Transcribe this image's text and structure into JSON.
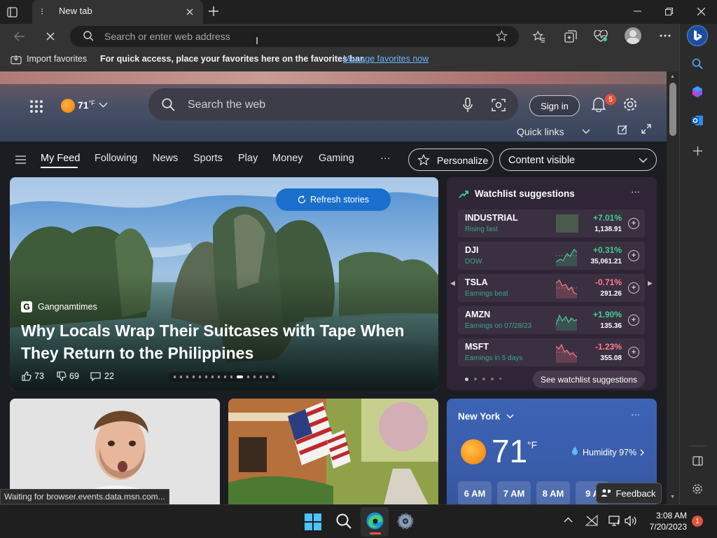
{
  "browser": {
    "tab_title": "New tab",
    "address_placeholder": "Search or enter web address",
    "favorites": {
      "import_label": "Import favorites",
      "hint": "For quick access, place your favorites here on the favorites bar.",
      "manage_link": "Manage favorites now"
    },
    "status_text": "Waiting for browser.events.data.msn.com..."
  },
  "msn": {
    "weather_chip": {
      "temp": "71",
      "unit": "°F"
    },
    "search_placeholder": "Search the web",
    "signin_label": "Sign in",
    "notification_count": "5",
    "quick_links_label": "Quick links",
    "nav": [
      "My Feed",
      "Following",
      "News",
      "Sports",
      "Play",
      "Money",
      "Gaming"
    ],
    "more_label": "···",
    "personalize_label": "Personalize",
    "content_visible_label": "Content visible",
    "hero": {
      "refresh_label": "Refresh stories",
      "source": "Gangnamtimes",
      "title": "Why Locals Wrap Their Suitcases with Tape When They Return to the Philippines",
      "likes": "73",
      "dislikes": "69",
      "comments": "22",
      "carousel_total": 16,
      "carousel_active": 10
    },
    "watchlist": {
      "title": "Watchlist suggestions",
      "more_label": "···",
      "stocks": [
        {
          "symbol": "INDUSTRIAL",
          "sub": "Rising fast",
          "change": "+7.01%",
          "value": "1,138.91",
          "trend": "up"
        },
        {
          "symbol": "DJI",
          "sub": "DOW",
          "change": "+0.31%",
          "value": "35,061.21",
          "trend": "up"
        },
        {
          "symbol": "TSLA",
          "sub": "Earnings beat",
          "change": "-0.71%",
          "value": "291.26",
          "trend": "down"
        },
        {
          "symbol": "AMZN",
          "sub": "Earnings on 07/28/23",
          "change": "+1.90%",
          "value": "135.36",
          "trend": "up"
        },
        {
          "symbol": "MSFT",
          "sub": "Earnings in 5 days",
          "change": "-1.23%",
          "value": "355.08",
          "trend": "down"
        }
      ],
      "see_more_label": "See watchlist suggestions"
    },
    "weather": {
      "city": "New York",
      "temp": "71",
      "unit": "°F",
      "humidity": "Humidity 97%",
      "hours": [
        "6 AM",
        "7 AM",
        "8 AM",
        "9 A"
      ]
    },
    "feedback_label": "Feedback"
  },
  "taskbar": {
    "time": "3:08 AM",
    "date": "7/20/2023",
    "notification_count": "1"
  },
  "colors": {
    "accent": "#1a6fcc",
    "up": "#3fcf8e",
    "down": "#ff7a8a",
    "badge": "#e0533d"
  }
}
